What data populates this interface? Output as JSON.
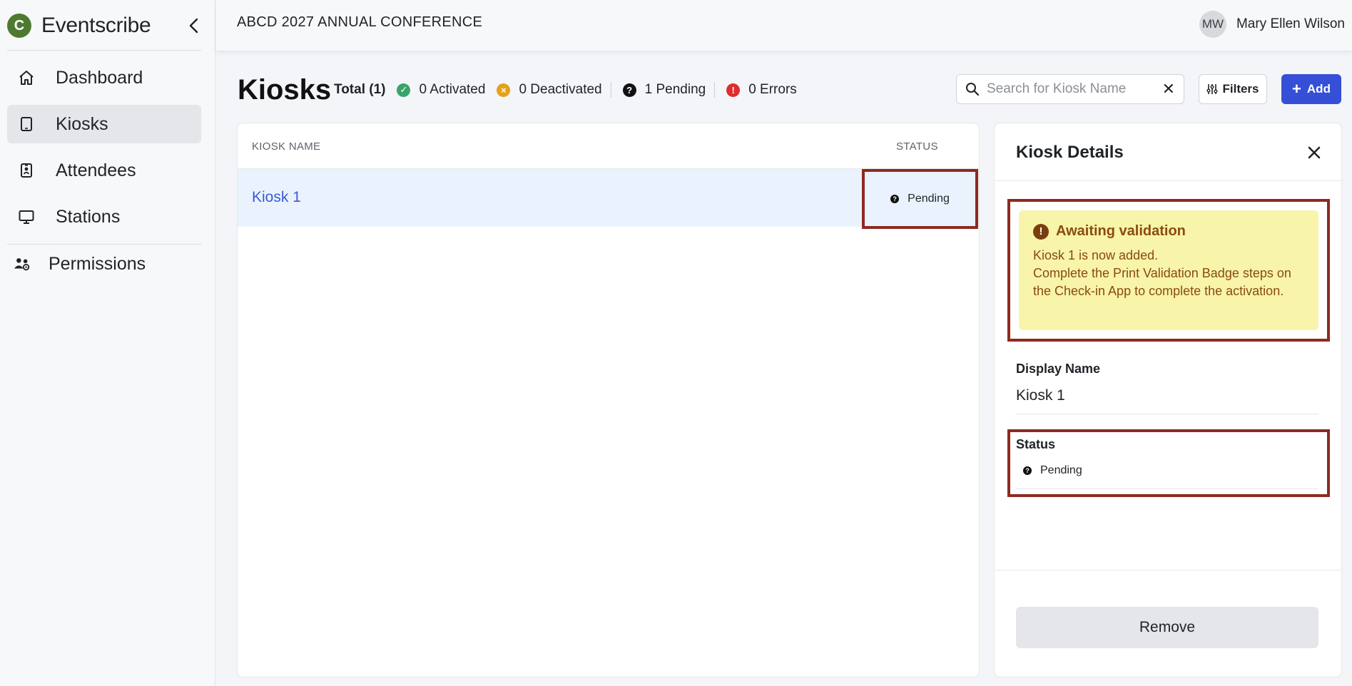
{
  "app": {
    "name": "Eventscribe",
    "logo_letter": "C"
  },
  "sidebar": {
    "items": [
      {
        "label": "Dashboard",
        "icon": "home-icon"
      },
      {
        "label": "Kiosks",
        "icon": "tablet-icon",
        "active": true
      },
      {
        "label": "Attendees",
        "icon": "badge-icon"
      },
      {
        "label": "Stations",
        "icon": "monitor-icon"
      },
      {
        "label": "Permissions",
        "icon": "users-icon"
      }
    ]
  },
  "header": {
    "event_title": "ABCD 2027 ANNUAL CONFERENCE",
    "user": {
      "initials": "MW",
      "name": "Mary Ellen Wilson"
    }
  },
  "page": {
    "title": "Kiosks",
    "stats": {
      "total": "Total (1)",
      "activated": "0 Activated",
      "deactivated": "0 Deactivated",
      "pending": "1 Pending",
      "errors": "0 Errors"
    },
    "search": {
      "placeholder": "Search for Kiosk Name",
      "value": ""
    },
    "filters_label": "Filters",
    "add_label": "Add"
  },
  "colors": {
    "activated": "#3aa36b",
    "deactivated": "#e2a21a",
    "pending": "#111111",
    "errors": "#e02d2d",
    "primary": "#3550d6"
  },
  "table": {
    "columns": [
      "KIOSK NAME",
      "STATUS"
    ],
    "rows": [
      {
        "name": "Kiosk 1",
        "status": "Pending"
      }
    ]
  },
  "details": {
    "title": "Kiosk Details",
    "alert": {
      "title": "Awaiting validation",
      "line1": "Kiosk 1 is now added.",
      "line2": "Complete the Print Validation Badge steps on the Check-in App to complete the activation."
    },
    "display_name_label": "Display Name",
    "display_name_value": "Kiosk 1",
    "status_label": "Status",
    "status_value": "Pending",
    "remove_label": "Remove"
  }
}
